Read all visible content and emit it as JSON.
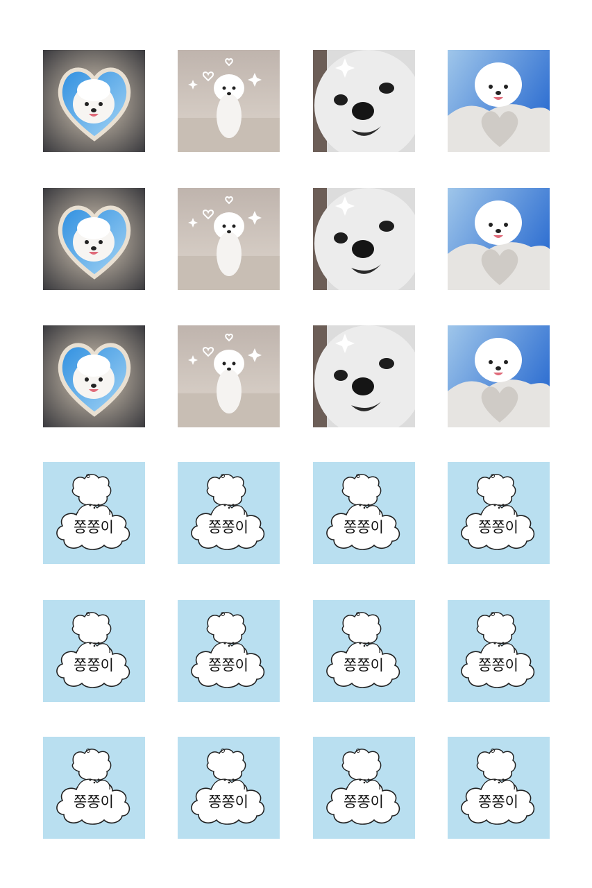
{
  "sticker": {
    "label": "쫑쫑이"
  },
  "colors": {
    "sky_tile": "#b9dff0",
    "photo_bg_warm": "#c9bfb8",
    "photo_sky": "#3f86d6"
  },
  "icons": [
    "dog-photo",
    "cloud-dog-sticker"
  ]
}
